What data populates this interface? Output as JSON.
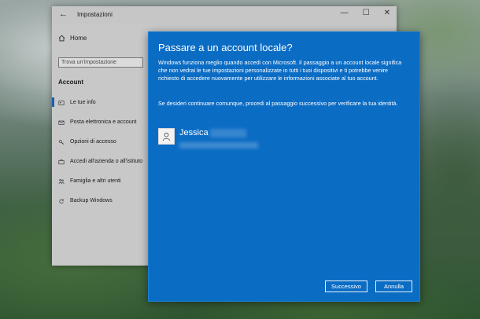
{
  "settings_window": {
    "title": "Impostazioni",
    "controls": [
      "—",
      "☐",
      "✕"
    ],
    "home_label": "Home",
    "search_placeholder": "Trova un'impostazione",
    "section": "Account",
    "nav_items": [
      {
        "label": "Le tue info",
        "icon": "person-card-icon",
        "active": true
      },
      {
        "label": "Posta elettronica e account",
        "icon": "mail-icon",
        "active": false
      },
      {
        "label": "Opzioni di accesso",
        "icon": "key-icon",
        "active": false
      },
      {
        "label": "Accedi all'azienda o all'istituto",
        "icon": "briefcase-icon",
        "active": false
      },
      {
        "label": "Famiglia e altri utenti",
        "icon": "people-icon",
        "active": false
      },
      {
        "label": "Backup Windows",
        "icon": "sync-icon",
        "active": false
      }
    ]
  },
  "dialog": {
    "title": "Passare a un account locale?",
    "paragraph1": "Windows funziona meglio quando accedi con Microsoft. Il passaggio a un account locale significa che non vedrai le tue impostazioni personalizzate in tutti i tuoi dispositivi e ti potrebbe venire richiesto di accedere nuovamente per utilizzare le informazioni associate al tuo account.",
    "paragraph2": "Se desideri continuare comunque, procedi al passaggio successivo per verificare la tua identità.",
    "user_name": "Jessica",
    "next_button": "Successivo",
    "cancel_button": "Annulla",
    "accent_color": "#0b6cc4"
  }
}
